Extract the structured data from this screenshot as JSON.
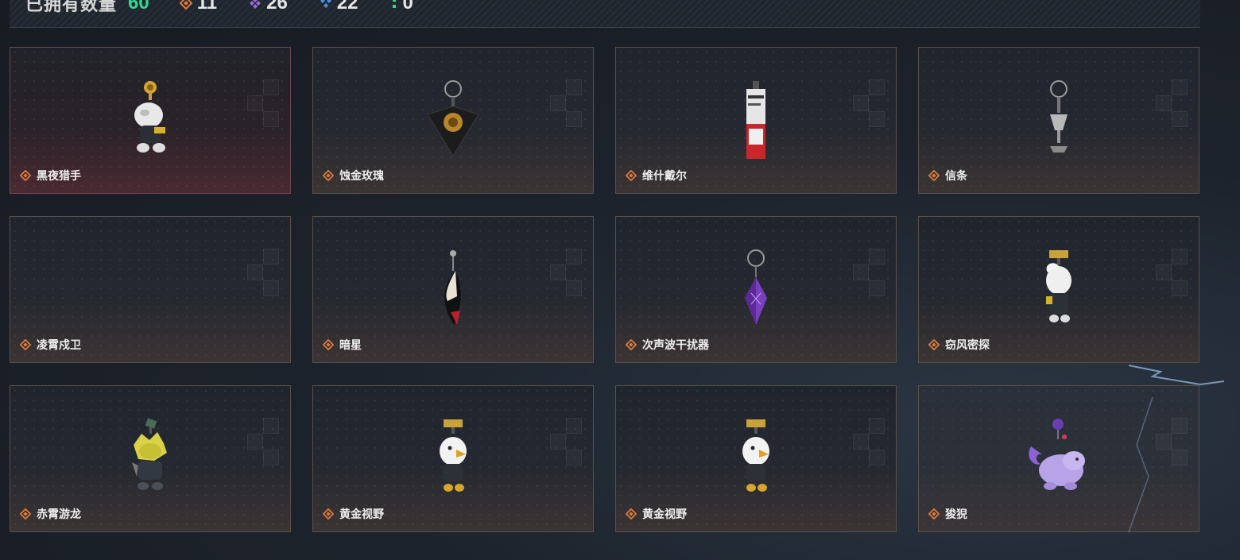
{
  "header": {
    "owned_label": "已拥有数量",
    "owned_count": "60",
    "stats": [
      {
        "icon": "orange-diamond-icon",
        "color": "#e07b3c",
        "value": "11"
      },
      {
        "icon": "purple-diamond-icon",
        "color": "#9b6ad9",
        "value": "26"
      },
      {
        "icon": "blue-diamond-icon",
        "color": "#4f8fe0",
        "value": "22"
      },
      {
        "icon": "green-dot-icon",
        "color": "#2fd98f",
        "value": "0"
      }
    ]
  },
  "items": [
    {
      "name": "黑夜猎手",
      "rarity": "orange",
      "icon": "hunter-charm-icon"
    },
    {
      "name": "蚀金玫瑰",
      "rarity": "orange",
      "icon": "rose-charm-icon"
    },
    {
      "name": "维什戴尔",
      "rarity": "orange",
      "icon": "card-charm-icon"
    },
    {
      "name": "信条",
      "rarity": "orange",
      "icon": "chalice-charm-icon"
    },
    {
      "name": "凌霄戍卫",
      "rarity": "orange",
      "icon": ""
    },
    {
      "name": "暗星",
      "rarity": "orange",
      "icon": "dark-star-charm-icon"
    },
    {
      "name": "次声波干扰器",
      "rarity": "orange",
      "icon": "crystal-charm-icon"
    },
    {
      "name": "窃风密探",
      "rarity": "orange",
      "icon": "spy-charm-icon"
    },
    {
      "name": "赤霄游龙",
      "rarity": "orange",
      "icon": "dragon-charm-icon"
    },
    {
      "name": "黄金视野",
      "rarity": "orange",
      "icon": "eagle-charm-icon"
    },
    {
      "name": "黄金视野",
      "rarity": "orange",
      "icon": "eagle-charm-icon"
    },
    {
      "name": "狻猊",
      "rarity": "orange",
      "icon": "lion-charm-icon"
    }
  ],
  "colors": {
    "rarity_orange": "#e07b3c",
    "owned_count": "#2fd98f"
  }
}
